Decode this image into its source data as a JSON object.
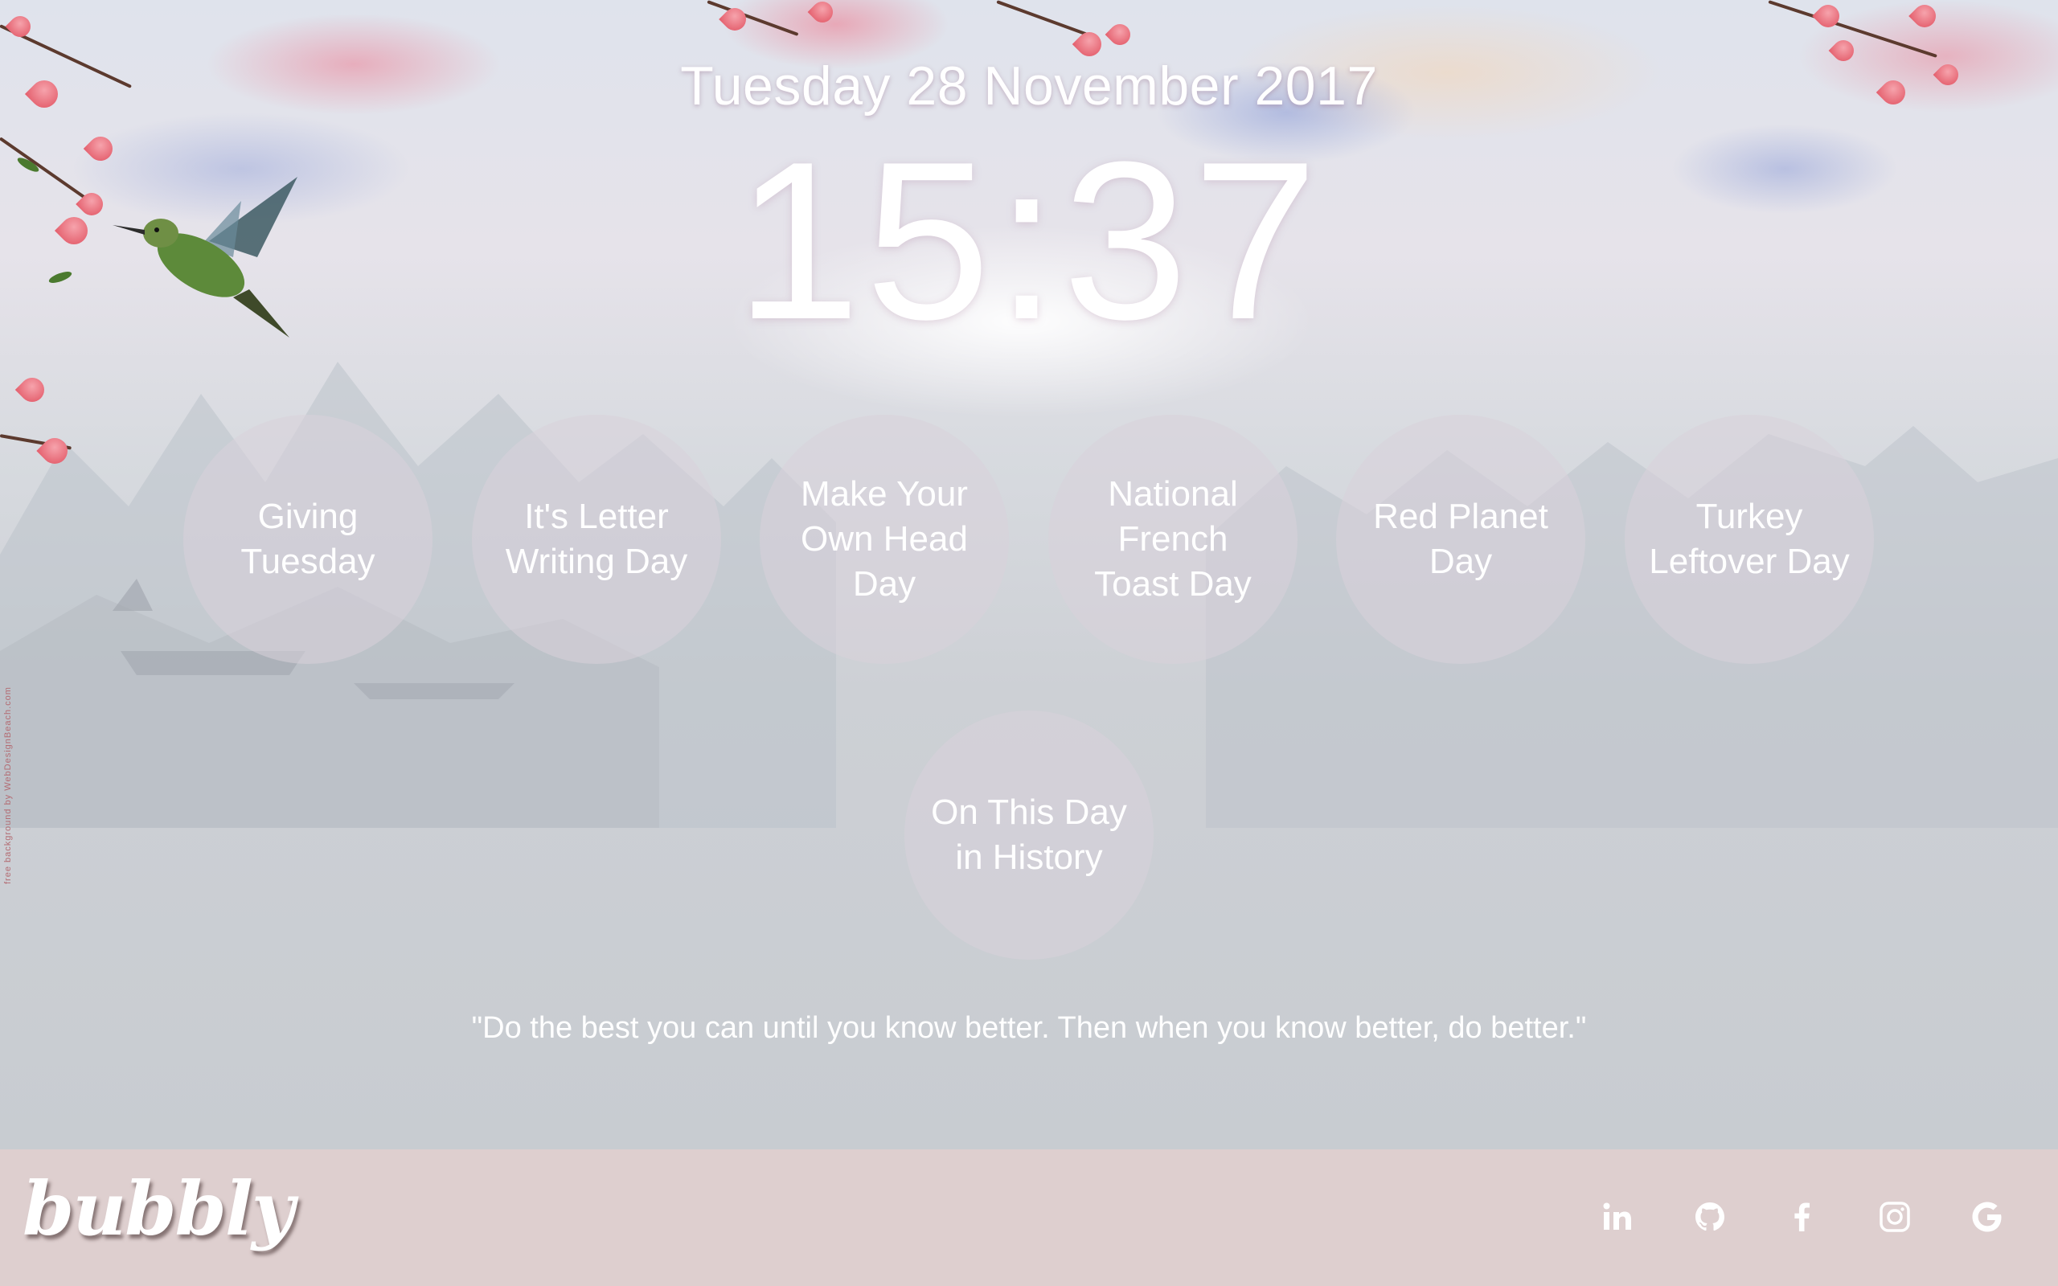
{
  "header": {
    "date": "Tuesday 28 November 2017",
    "time": "15:37"
  },
  "bubbles": [
    {
      "label": "Giving Tuesday"
    },
    {
      "label": "It's Letter Writing Day"
    },
    {
      "label": "Make Your Own Head Day"
    },
    {
      "label": "National French Toast Day"
    },
    {
      "label": "Red Planet Day"
    },
    {
      "label": "Turkey Leftover Day"
    },
    {
      "label": "On This Day in History"
    }
  ],
  "quote": "\"Do the best you can until you know better. Then when you know better, do better.\"",
  "credit": "free background by WebDesignBeach.com",
  "footer": {
    "logo": "bubbly",
    "social": [
      {
        "icon": "linkedin-icon"
      },
      {
        "icon": "github-icon"
      },
      {
        "icon": "facebook-icon"
      },
      {
        "icon": "instagram-icon"
      },
      {
        "icon": "google-icon"
      }
    ]
  }
}
